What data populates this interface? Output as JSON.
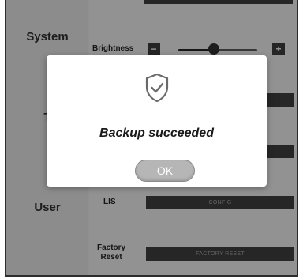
{
  "sidebar": {
    "items": [
      {
        "label": "System"
      },
      {
        "label": "T"
      },
      {
        "label": "User"
      }
    ]
  },
  "settings": {
    "brightness": {
      "label": "Brightness",
      "minus": "−",
      "plus": "+",
      "level": 0.45
    },
    "lis": {
      "label": "LIS",
      "button": "CONFIG"
    },
    "factory_reset": {
      "label_line1": "Factory",
      "label_line2": "Reset",
      "button": "FACTORY RESET"
    }
  },
  "dialog": {
    "icon": "shield-check-icon",
    "message": "Backup succeeded",
    "ok_label": "OK"
  }
}
